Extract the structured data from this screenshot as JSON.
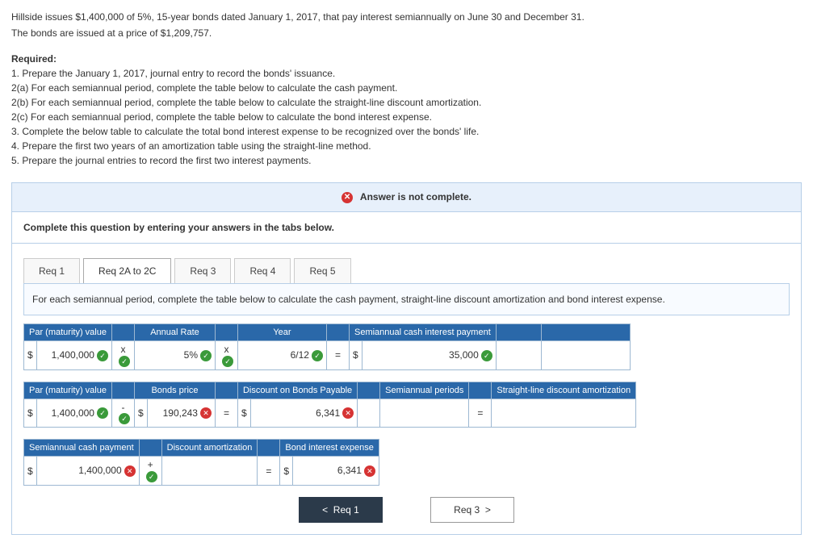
{
  "intro": {
    "line1": "Hillside issues $1,400,000 of 5%, 15-year bonds dated January 1, 2017, that pay interest semiannually on June 30 and December 31.",
    "line2": "The bonds are issued at a price of $1,209,757."
  },
  "required": {
    "title": "Required:",
    "r1": "1. Prepare the January 1, 2017, journal entry to record the bonds' issuance.",
    "r2a": "2(a) For each semiannual period, complete the table below to calculate the cash payment.",
    "r2b": "2(b) For each semiannual period, complete the table below to calculate the straight-line discount amortization.",
    "r2c": "2(c) For each semiannual period, complete the table below to calculate the bond interest expense.",
    "r3": "3. Complete the below table to calculate the total bond interest expense to be recognized over the bonds' life.",
    "r4": "4. Prepare the first two years of an amortization table using the straight-line method.",
    "r5": "5. Prepare the journal entries to record the first two interest payments."
  },
  "banner": {
    "text": "Answer is not complete."
  },
  "instruction": "Complete this question by entering your answers in the tabs below.",
  "tabs": {
    "t1": "Req 1",
    "t2": "Req 2A to 2C",
    "t3": "Req 3",
    "t4": "Req 4",
    "t5": "Req 5"
  },
  "tabdesc": "For each semiannual period, complete the table below to calculate the cash payment, straight-line discount amortization and bond interest expense.",
  "table1": {
    "h1": "Par (maturity) value",
    "h2": "Annual Rate",
    "h3": "Year",
    "h4": "Semiannual cash interest payment",
    "v1": "1,400,000",
    "v2": "5%",
    "v3": "6/12",
    "v4": "35,000",
    "op1": "x",
    "op2": "x",
    "eq": "="
  },
  "table2": {
    "h1": "Par (maturity) value",
    "h2": "Bonds price",
    "h3": "Discount on Bonds Payable",
    "h4": "Semiannual periods",
    "h5": "Straight-line discount amortization",
    "v1": "1,400,000",
    "v2": "190,243",
    "v3": "6,341",
    "op1": "-",
    "eq": "="
  },
  "table3": {
    "h1": "Semiannual cash payment",
    "h2": "Discount amortization",
    "h3": "Bond interest expense",
    "v1": "1,400,000",
    "v3": "6,341",
    "op1": "+",
    "eq": "="
  },
  "currency": "$",
  "nav": {
    "prev": "Req 1",
    "next": "Req 3"
  }
}
